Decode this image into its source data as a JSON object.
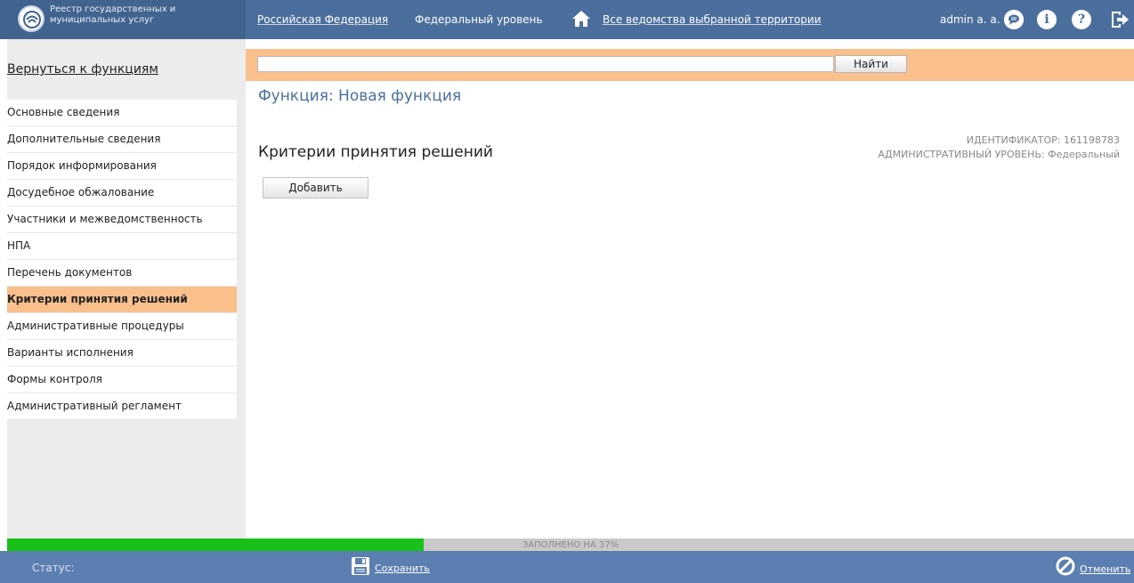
{
  "header": {
    "logo_text": "Реестр государственных и муниципальных услуг",
    "region": "Российская Федерация",
    "level": "Федеральный уровень",
    "agencies": "Все ведомства выбранной территории",
    "user": "admin a. a.",
    "icons": [
      "home-icon",
      "chat-icon",
      "info-icon",
      "help-icon",
      "exit-icon"
    ]
  },
  "sidebar": {
    "back_link": "Вернуться к функциям",
    "items": [
      {
        "label": "Основные сведения"
      },
      {
        "label": "Дополнительные сведения"
      },
      {
        "label": "Порядок информирования"
      },
      {
        "label": "Досудебное обжалование"
      },
      {
        "label": "Участники и межведомственность"
      },
      {
        "label": "НПА"
      },
      {
        "label": "Перечень документов"
      },
      {
        "label": "Критерии принятия решений",
        "active": true
      },
      {
        "label": "Административные процедуры"
      },
      {
        "label": "Варианты исполнения"
      },
      {
        "label": "Формы контроля"
      },
      {
        "label": "Административный регламент"
      }
    ]
  },
  "search": {
    "value": "",
    "button_label": "Найти"
  },
  "main": {
    "function_title": "Функция: Новая функция",
    "section_title": "Критерии принятия решений",
    "identifier": "ИДЕНТИФИКАТОР: 161198783",
    "admin_level": "АДМИНИСТРАТИВНЫЙ УРОВЕНЬ: Федеральный",
    "add_button": "Добавить"
  },
  "footer": {
    "progress_fraction": 0.37,
    "progress_text": "ЗАПОЛНЕНО НА 37%",
    "status_label": "Статус:",
    "save_label": "Сохранить",
    "cancel_label": "Отменить"
  },
  "colors": {
    "header_bg": "#4a6f9c",
    "accent_orange": "#f9c08c",
    "progress_green": "#18c018",
    "footer_bg": "#5b7fb0"
  }
}
